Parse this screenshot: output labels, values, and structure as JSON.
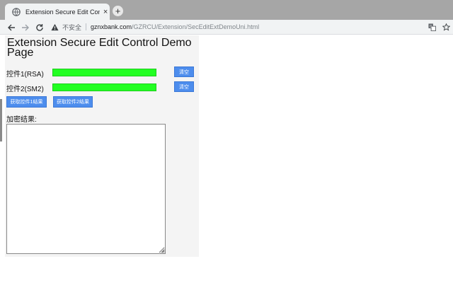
{
  "browser": {
    "tab_title": "Extension Secure Edit Control",
    "tab_close": "×",
    "new_tab": "+",
    "security_label": "不安全",
    "url_host": "gznxbank.com",
    "url_path": "/GZRCU/Extension/SecEditExtDemoUni.html"
  },
  "page": {
    "title": "Extension Secure Edit Control Demo Page",
    "rows": [
      {
        "label": "控件1(RSA)",
        "clear_label": "清空"
      },
      {
        "label": "控件2(SM2)",
        "clear_label": "清空"
      }
    ],
    "get_result1_label": "获取控件1结果",
    "get_result2_label": "获取控件2结果",
    "result_label": "加密结果:",
    "result_value": ""
  },
  "colors": {
    "edit_control_fill": "#22ff22",
    "button_fill": "#4d8ded",
    "tabstrip": "#a6a6a6"
  }
}
